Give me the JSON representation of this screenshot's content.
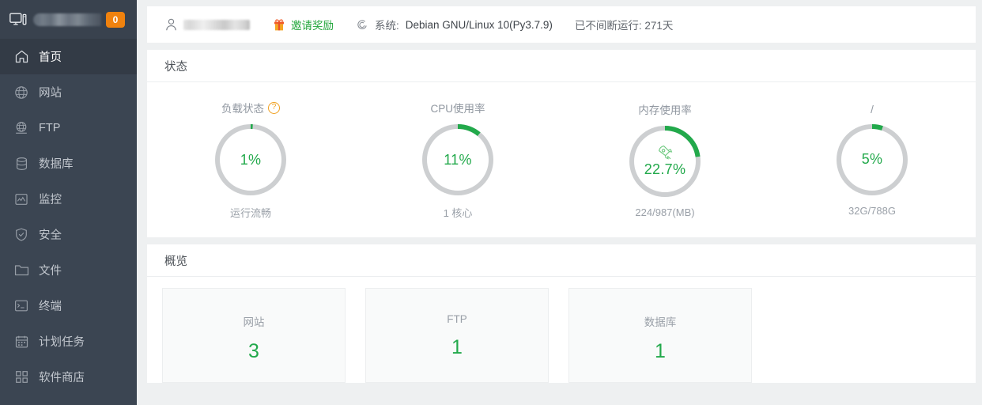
{
  "sidebar": {
    "logo": {
      "icon": "monitor-icon",
      "name_redacted": true,
      "badge": "0"
    },
    "items": [
      {
        "label": "首页",
        "icon": "home-icon",
        "active": true
      },
      {
        "label": "网站",
        "icon": "globe-icon",
        "active": false
      },
      {
        "label": "FTP",
        "icon": "ftp-globe-icon",
        "active": false
      },
      {
        "label": "数据库",
        "icon": "database-icon",
        "active": false
      },
      {
        "label": "监控",
        "icon": "monitor-chart-icon",
        "active": false
      },
      {
        "label": "安全",
        "icon": "shield-check-icon",
        "active": false
      },
      {
        "label": "文件",
        "icon": "folder-icon",
        "active": false
      },
      {
        "label": "终端",
        "icon": "terminal-icon",
        "active": false
      },
      {
        "label": "计划任务",
        "icon": "calendar-icon",
        "active": false
      },
      {
        "label": "软件商店",
        "icon": "grid-apps-icon",
        "active": false
      }
    ]
  },
  "infobar": {
    "user_icon": "user-icon",
    "user_name_redacted": true,
    "gift_icon": "gift-icon",
    "gift_label": "邀请奖励",
    "os_icon": "debian-icon",
    "system_label": "系统:",
    "system_value": "Debian GNU/Linux 10(Py3.7.9)",
    "uptime": "已不间断运行: 271天"
  },
  "status": {
    "title": "状态",
    "gauges": [
      {
        "title": "负载状态",
        "help": "?",
        "value": "1%",
        "percent": 1,
        "sub": "运行流畅",
        "icon": ""
      },
      {
        "title": "CPU使用率",
        "help": "",
        "value": "11%",
        "percent": 11,
        "sub": "1 核心",
        "icon": ""
      },
      {
        "title": "内存使用率",
        "help": "",
        "value": "22.7%",
        "percent": 22.7,
        "sub": "224/987(MB)",
        "icon": "rocket-icon"
      },
      {
        "title": "/",
        "help": "",
        "value": "5%",
        "percent": 5,
        "sub": "32G/788G",
        "icon": ""
      }
    ]
  },
  "overview": {
    "title": "概览",
    "cards": [
      {
        "label": "网站",
        "value": "3"
      },
      {
        "label": "FTP",
        "value": "1"
      },
      {
        "label": "数据库",
        "value": "1"
      }
    ]
  },
  "colors": {
    "accent_green": "#22a94b",
    "ring_track": "#cdcfd1",
    "badge_orange": "#f0820e",
    "sidebar_bg": "#3b4552",
    "sidebar_active": "#333b46",
    "help_orange": "#f0a020"
  }
}
